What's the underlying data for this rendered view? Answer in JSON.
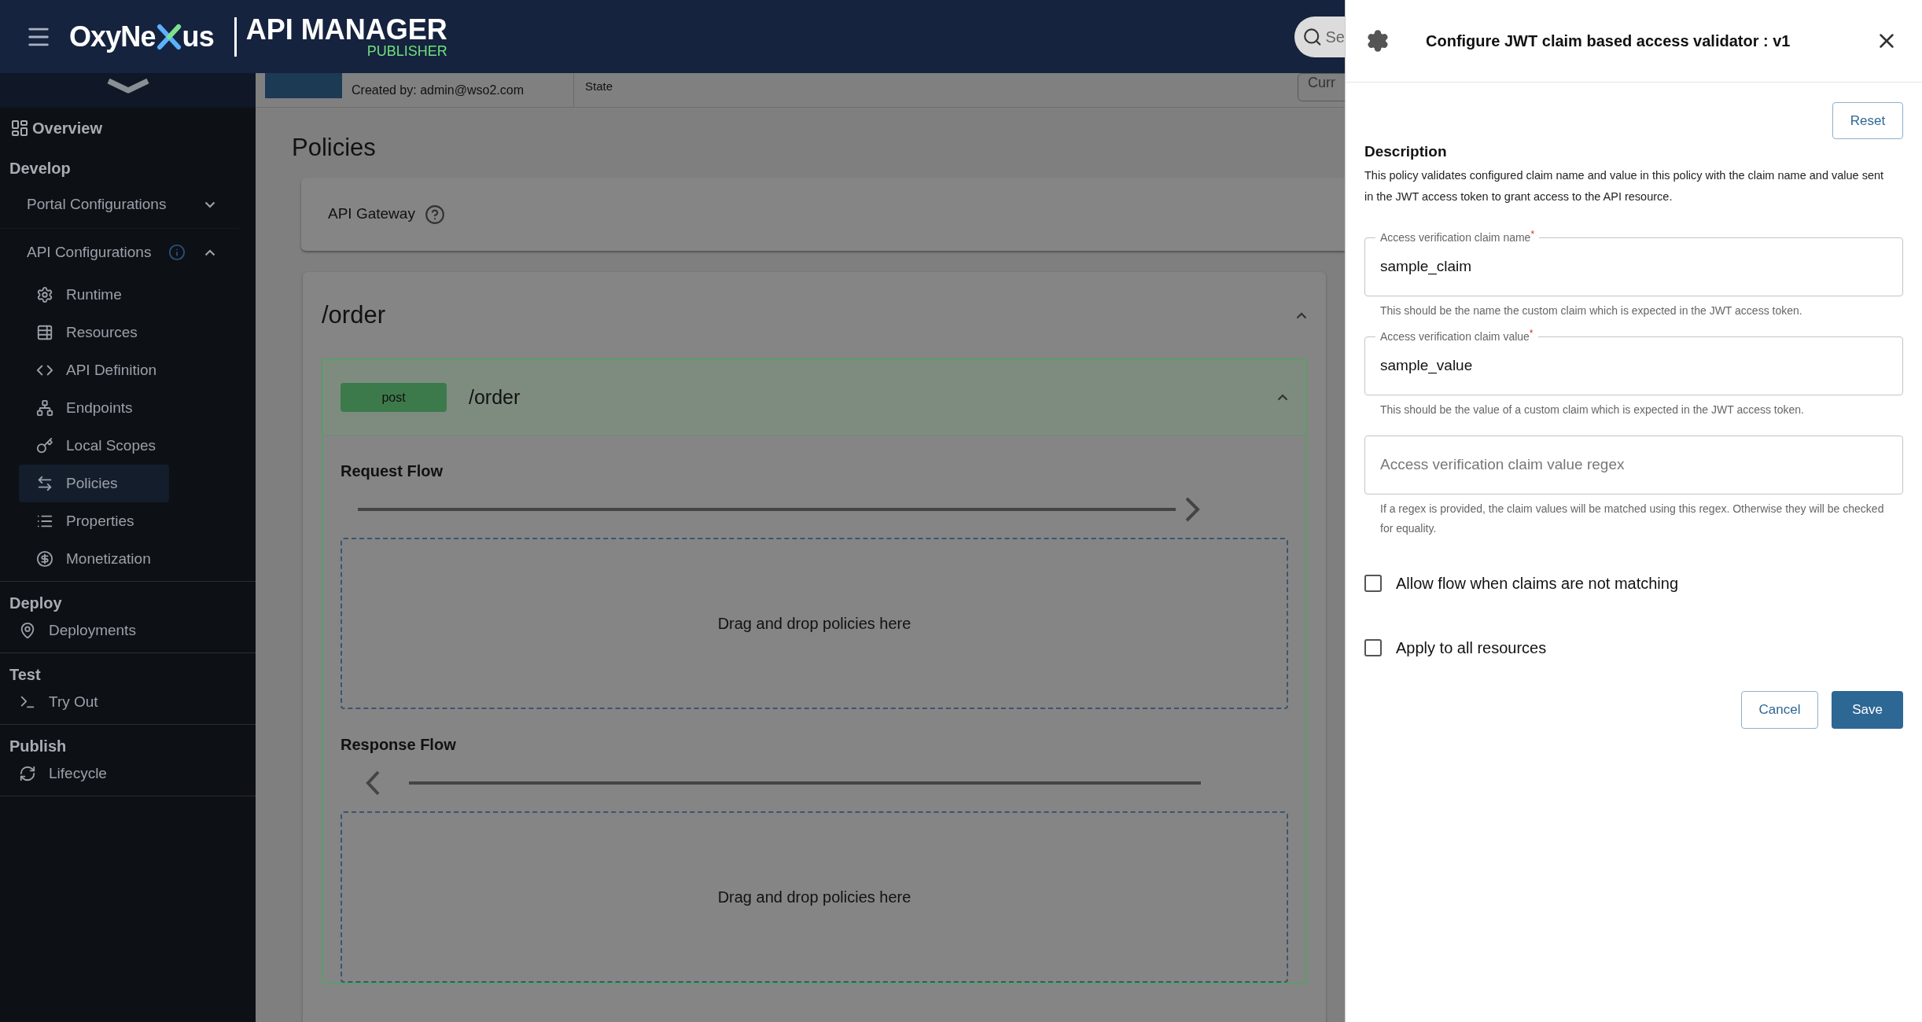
{
  "header": {
    "logo_left": "OxyNe",
    "logo_right": "us",
    "product": "API MANAGER",
    "subtitle": "PUBLISHER",
    "search_placeholder": "Se"
  },
  "api_info": {
    "created_by": "Created by: admin@wso2.com",
    "state_label": "State",
    "button": "Curr"
  },
  "sidebar": {
    "overview": "Overview",
    "sections": [
      {
        "title": "Develop",
        "groups": [
          {
            "label": "Portal Configurations",
            "expanded": false,
            "info": false
          },
          {
            "label": "API Configurations",
            "expanded": true,
            "info": true,
            "items": [
              {
                "label": "Runtime",
                "selected": false
              },
              {
                "label": "Resources",
                "selected": false
              },
              {
                "label": "API Definition",
                "selected": false
              },
              {
                "label": "Endpoints",
                "selected": false
              },
              {
                "label": "Local Scopes",
                "selected": false
              },
              {
                "label": "Policies",
                "selected": true
              },
              {
                "label": "Properties",
                "selected": false
              },
              {
                "label": "Monetization",
                "selected": false
              }
            ]
          }
        ]
      },
      {
        "title": "Deploy",
        "items": [
          {
            "label": "Deployments",
            "selected": false
          }
        ]
      },
      {
        "title": "Test",
        "items": [
          {
            "label": "Try Out",
            "selected": false
          }
        ]
      },
      {
        "title": "Publish",
        "items": [
          {
            "label": "Lifecycle",
            "selected": false
          }
        ]
      }
    ]
  },
  "main": {
    "title": "Policies",
    "gateway": "API Gateway",
    "resource": {
      "path": "/order",
      "expanded": true,
      "operations": [
        {
          "method": "post",
          "path": "/order",
          "expanded": true,
          "flows": [
            {
              "kind": "request",
              "label": "Request Flow",
              "dropzone": "Drag and drop policies here"
            },
            {
              "kind": "response",
              "label": "Response Flow",
              "dropzone": "Drag and drop policies here"
            }
          ]
        }
      ]
    }
  },
  "drawer": {
    "title": "Configure JWT claim based access validator : v1",
    "reset": "Reset",
    "description_title": "Description",
    "description": "This policy validates configured claim name and value in this policy with the claim name and value sent in the JWT access token to grant access to the API resource.",
    "fields": [
      {
        "label": "Access verification claim name",
        "required_mark": "*",
        "value": "sample_claim",
        "helper": "This should be the name the custom claim which is expected in the JWT access token."
      },
      {
        "label": "Access verification claim value",
        "required_mark": "*",
        "value": "sample_value",
        "helper": "This should be the value of a custom claim which is expected in the JWT access token."
      },
      {
        "placeholder": "Access verification claim value regex",
        "helper": "If a regex is provided, the claim values will be matched using this regex. Otherwise they will be checked for equality."
      }
    ],
    "checkboxes": [
      {
        "label": "Allow flow when claims are not matching",
        "checked": false
      },
      {
        "label": "Apply to all resources",
        "checked": false
      }
    ],
    "cancel": "Cancel",
    "save": "Save"
  }
}
